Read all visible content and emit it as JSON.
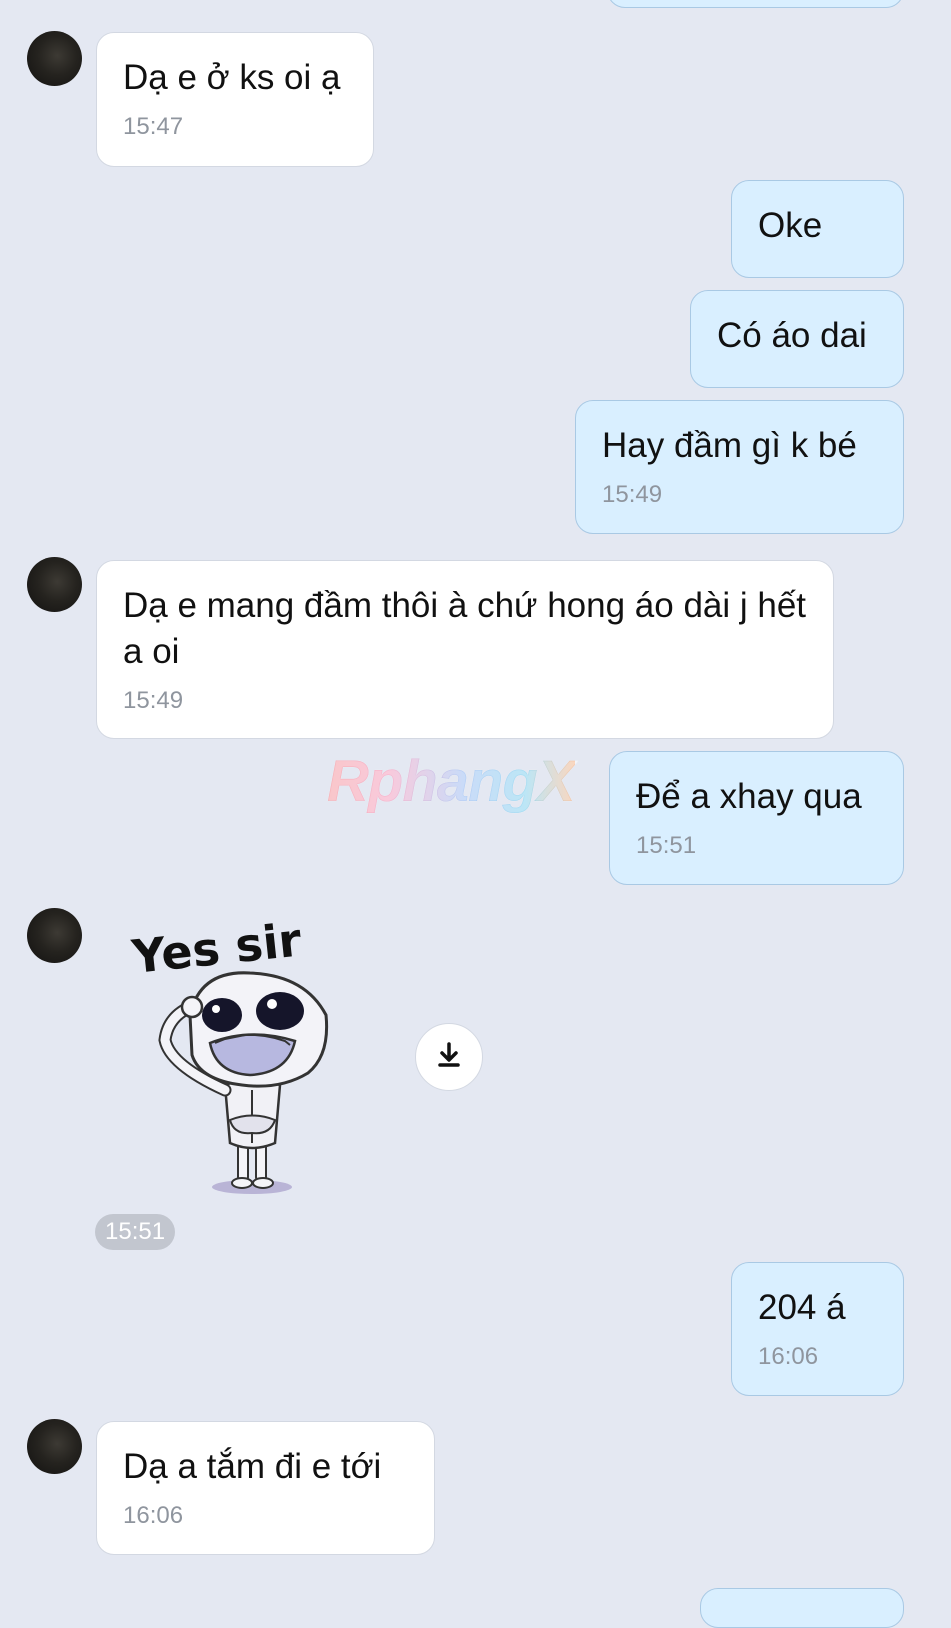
{
  "messages": [
    {
      "text": "Dạ e ở ks oi ạ",
      "time": "15:47"
    },
    {
      "text": "Oke"
    },
    {
      "text": "Có áo dai"
    },
    {
      "text": "Hay đầm gì k bé",
      "time": "15:49"
    },
    {
      "text": "Dạ e mang đầm thôi à chứ hong áo dài j hết a oi",
      "time": "15:49"
    },
    {
      "text": "Để a xhay qua",
      "time": "15:51"
    },
    {
      "text": "204 á",
      "time": "16:06"
    },
    {
      "text": "Dạ a tắm đi e tới",
      "time": "16:06"
    }
  ],
  "sticker": {
    "caption": "Yes sir",
    "time": "15:51",
    "icon": "download-icon"
  },
  "watermark": "RphangX",
  "colors": {
    "background": "#e4e8f2",
    "incoming_bubble": "#ffffff",
    "outgoing_bubble": "#d9efff",
    "outgoing_border": "#a9c9e4",
    "time_text": "#8f959e"
  }
}
